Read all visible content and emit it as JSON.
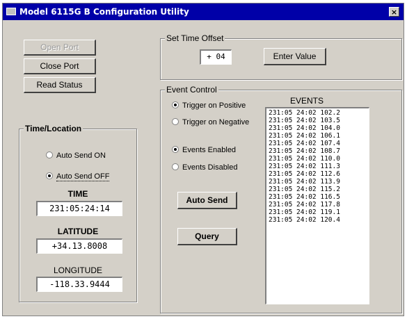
{
  "window": {
    "title": "Model 6115G B Configuration Utility",
    "close_label": "×"
  },
  "buttons": {
    "open_port": "Open Port",
    "close_port": "Close Port",
    "read_status": "Read Status",
    "enter_value": "Enter Value",
    "auto_send": "Auto Send",
    "query": "Query"
  },
  "time_offset": {
    "legend": "Set Time Offset",
    "value": "+ 04"
  },
  "time_location": {
    "legend": "Time/Location",
    "auto_send_on": "Auto Send ON",
    "auto_send_off": "Auto Send OFF",
    "time_label": "TIME",
    "time_value": "231:05:24:14",
    "latitude_label": "LATITUDE",
    "latitude_value": "+34.13.8008",
    "longitude_label": "LONGITUDE",
    "longitude_value": "-118.33.9444"
  },
  "event_control": {
    "legend": "Event Control",
    "trigger_positive": "Trigger on Positive",
    "trigger_negative": "Trigger on Negative",
    "events_enabled": "Events Enabled",
    "events_disabled": "Events Disabled",
    "events_header": "EVENTS",
    "events": [
      "231:05 24:02 102.2",
      "231:05 24:02 103.5",
      "231:05 24:02 104.0",
      "231:05 24:02 106.1",
      "231:05 24:02 107.4",
      "231:05 24:02 108.7",
      "231:05 24:02 110.0",
      "231:05 24:02 111.3",
      "231:05 24:02 112.6",
      "231:05 24:02 113.9",
      "231:05 24:02 115.2",
      "231:05 24:02 116.5",
      "231:05 24:02 117.8",
      "231:05 24:02 119.1",
      "231:05 24:02 120.4"
    ]
  }
}
